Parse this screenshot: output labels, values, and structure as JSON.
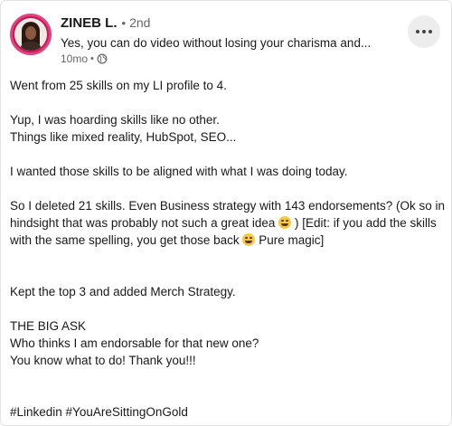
{
  "author": {
    "name": "ZINEB L.",
    "separator": "•",
    "degree": "2nd",
    "headline": "Yes, you can do video without losing your charisma and..."
  },
  "meta": {
    "time": "10mo",
    "separator": "•",
    "visibility_icon": "globe-icon"
  },
  "menu": {
    "icon": "more-icon"
  },
  "post": {
    "line1": "Went from 25 skills on my LI profile to 4.",
    "line2": "Yup, I was hoarding skills like no other.",
    "line3": "Things like mixed reality, HubSpot, SEO...",
    "line4": "I wanted those skills to be aligned with what I was doing today.",
    "line5": "So I deleted 21 skills. Even Business strategy with 143 endorsements? (Ok so in",
    "line6_a": "hindsight that was probably not such a great idea",
    "emoji1": "winking-face-emoji",
    "line6_b": ") [Edit: if you add the skills",
    "line7_a": "with the same spelling, you get those back",
    "emoji2": "grinning-face-emoji",
    "line7_b": "Pure magic]",
    "line8": "Kept the top 3 and added Merch Strategy.",
    "line9": "THE BIG ASK",
    "line10": "Who thinks I am endorsable for that new one?",
    "line11": "You know what to do! Thank you!!!",
    "hashtags": "#Linkedin #YouAreSittingOnGold"
  },
  "colors": {
    "avatar_ring": "#e0427b",
    "text": "#191919",
    "secondary_text": "#666666"
  }
}
